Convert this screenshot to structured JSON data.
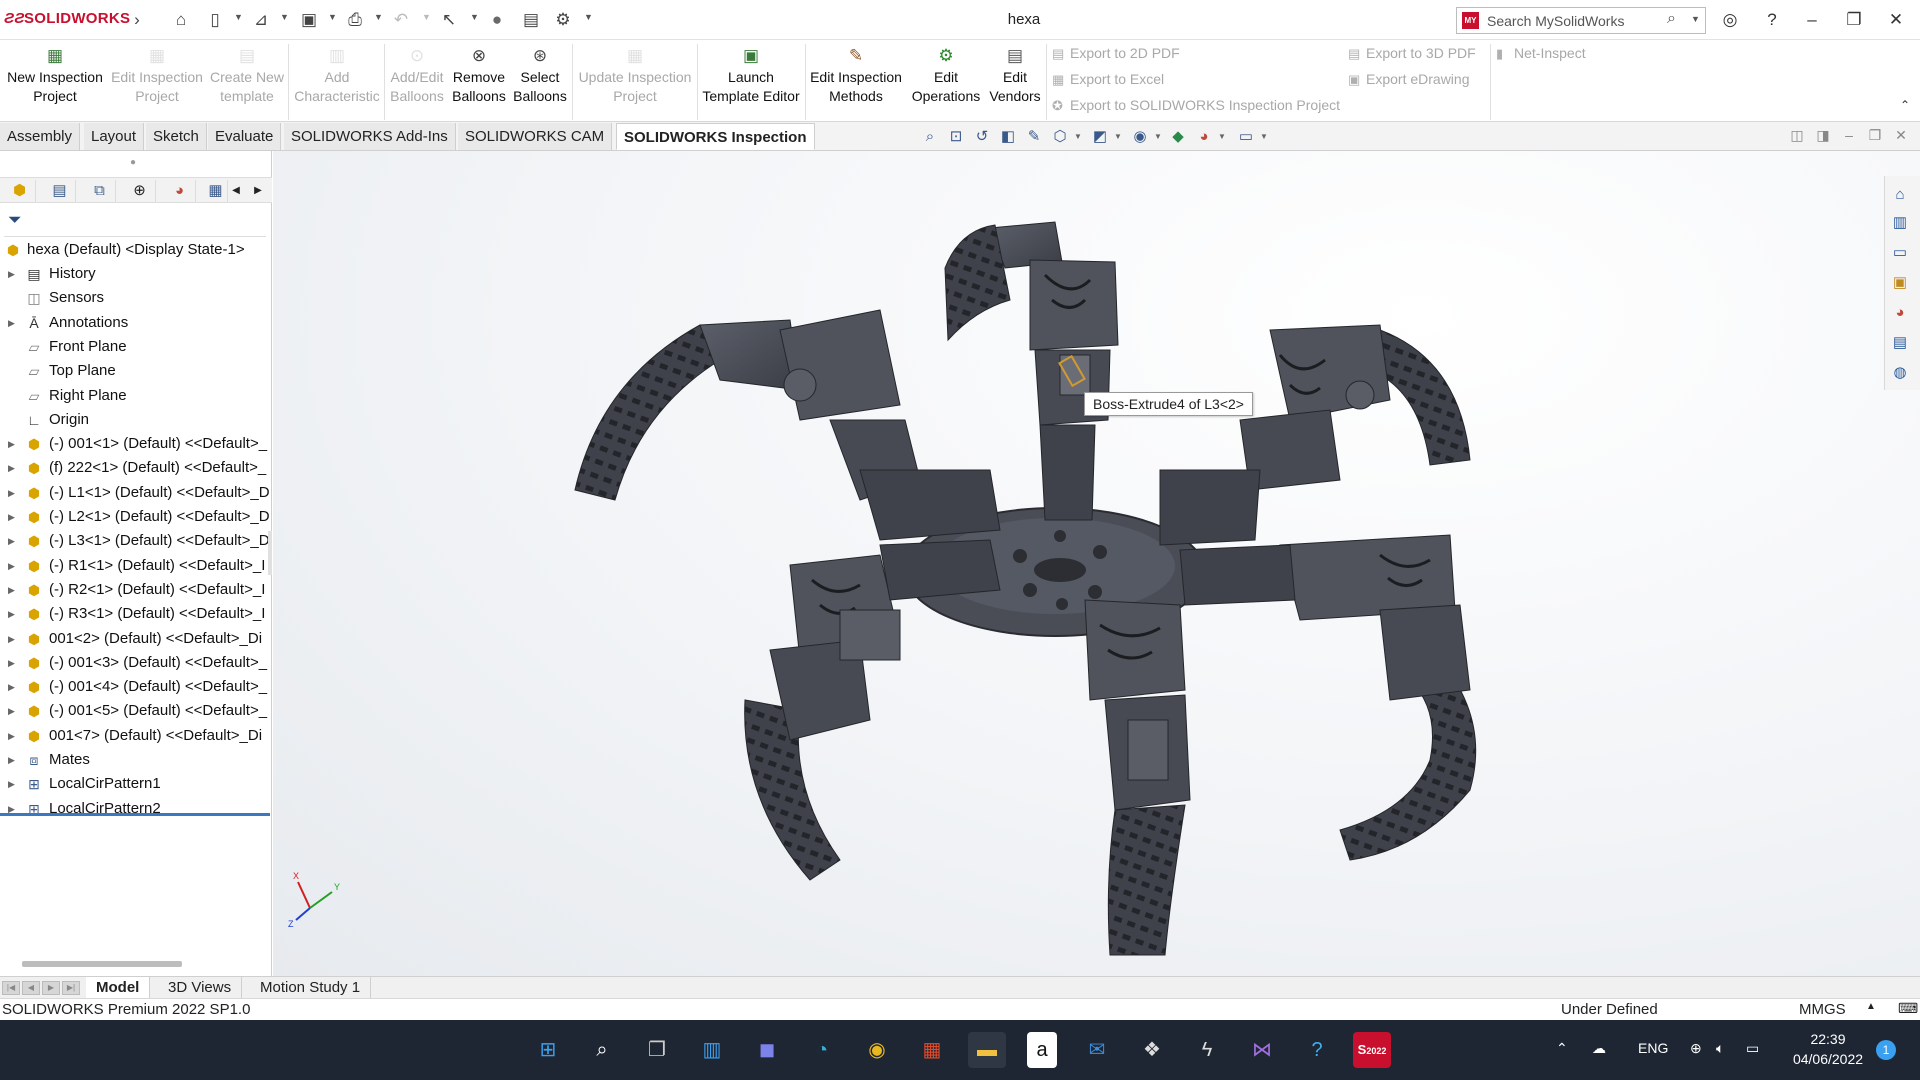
{
  "app": {
    "brand": "SOLIDWORKS",
    "document_title": "hexa",
    "search_placeholder": "Search MySolidWorks",
    "accent_color": "#c8102e"
  },
  "ribbon": {
    "buttons": [
      {
        "label": "New Inspection\nProject",
        "enabled": true,
        "icon": "new-inspection-project-icon"
      },
      {
        "label": "Edit Inspection\nProject",
        "enabled": false,
        "icon": "edit-inspection-project-icon"
      },
      {
        "label": "Create New\ntemplate",
        "enabled": false,
        "icon": "create-template-icon"
      },
      {
        "label": "Add\nCharacteristic",
        "enabled": false,
        "icon": "add-characteristic-icon"
      },
      {
        "label": "Add/Edit\nBalloons",
        "enabled": false,
        "icon": "add-edit-balloons-icon"
      },
      {
        "label": "Remove\nBalloons",
        "enabled": true,
        "icon": "remove-balloons-icon"
      },
      {
        "label": "Select\nBalloons",
        "enabled": true,
        "icon": "select-balloons-icon"
      },
      {
        "label": "Update Inspection\nProject",
        "enabled": false,
        "icon": "update-inspection-project-icon"
      },
      {
        "label": "Launch\nTemplate Editor",
        "enabled": true,
        "icon": "launch-template-editor-icon"
      },
      {
        "label": "Edit Inspection\nMethods",
        "enabled": true,
        "icon": "edit-inspection-methods-icon"
      },
      {
        "label": "Edit\nOperations",
        "enabled": true,
        "icon": "edit-operations-icon"
      },
      {
        "label": "Edit\nVendors",
        "enabled": true,
        "icon": "edit-vendors-icon"
      }
    ],
    "exports": {
      "pdf2d": "Export to 2D PDF",
      "excel": "Export to Excel",
      "inspection_project": "Export to SOLIDWORKS Inspection Project",
      "pdf3d": "Export to 3D PDF",
      "edrawing": "Export eDrawing",
      "net_inspect": "Net-Inspect"
    }
  },
  "tabs": [
    {
      "label": "Assembly",
      "active": false
    },
    {
      "label": "Layout",
      "active": false
    },
    {
      "label": "Sketch",
      "active": false
    },
    {
      "label": "Evaluate",
      "active": false
    },
    {
      "label": "SOLIDWORKS Add-Ins",
      "active": false
    },
    {
      "label": "SOLIDWORKS CAM",
      "active": false
    },
    {
      "label": "SOLIDWORKS Inspection",
      "active": true
    }
  ],
  "feature_tree": {
    "root": "hexa (Default) <Display State-1>",
    "items": [
      {
        "label": "History",
        "expandable": true,
        "icon": "history-icon"
      },
      {
        "label": "Sensors",
        "expandable": false,
        "icon": "sensors-icon"
      },
      {
        "label": "Annotations",
        "expandable": true,
        "icon": "annotations-icon"
      },
      {
        "label": "Front Plane",
        "expandable": false,
        "icon": "plane-icon"
      },
      {
        "label": "Top Plane",
        "expandable": false,
        "icon": "plane-icon"
      },
      {
        "label": "Right Plane",
        "expandable": false,
        "icon": "plane-icon"
      },
      {
        "label": "Origin",
        "expandable": false,
        "icon": "origin-icon"
      },
      {
        "label": "(-) 001<1> (Default) <<Default>_",
        "expandable": true,
        "icon": "part-icon"
      },
      {
        "label": "(f) 222<1> (Default) <<Default>_",
        "expandable": true,
        "icon": "part-icon"
      },
      {
        "label": "(-) L1<1> (Default) <<Default>_D",
        "expandable": true,
        "icon": "part-icon"
      },
      {
        "label": "(-) L2<1> (Default) <<Default>_D",
        "expandable": true,
        "icon": "part-icon"
      },
      {
        "label": "(-) L3<1> (Default) <<Default>_D",
        "expandable": true,
        "icon": "part-icon"
      },
      {
        "label": "(-) R1<1> (Default) <<Default>_I",
        "expandable": true,
        "icon": "part-icon"
      },
      {
        "label": "(-) R2<1> (Default) <<Default>_I",
        "expandable": true,
        "icon": "part-icon"
      },
      {
        "label": "(-) R3<1> (Default) <<Default>_I",
        "expandable": true,
        "icon": "part-icon"
      },
      {
        "label": "001<2> (Default) <<Default>_Di",
        "expandable": true,
        "icon": "part-icon"
      },
      {
        "label": "(-) 001<3> (Default) <<Default>_",
        "expandable": true,
        "icon": "part-icon"
      },
      {
        "label": "(-) 001<4> (Default) <<Default>_",
        "expandable": true,
        "icon": "part-icon"
      },
      {
        "label": "(-) 001<5> (Default) <<Default>_",
        "expandable": true,
        "icon": "part-icon"
      },
      {
        "label": "001<7> (Default) <<Default>_Di",
        "expandable": true,
        "icon": "part-icon"
      },
      {
        "label": "Mates",
        "expandable": true,
        "icon": "mates-icon"
      },
      {
        "label": "LocalCirPattern1",
        "expandable": true,
        "icon": "pattern-icon"
      },
      {
        "label": "LocalCirPattern2",
        "expandable": true,
        "icon": "pattern-icon"
      }
    ]
  },
  "viewport": {
    "tooltip": "Boss-Extrude4 of L3<2>",
    "model_color": "#4c4f58",
    "triad": {
      "x": "X",
      "y": "Y",
      "z": "Z"
    }
  },
  "bottom_tabs": [
    {
      "label": "Model",
      "active": true
    },
    {
      "label": "3D Views",
      "active": false
    },
    {
      "label": "Motion Study 1",
      "active": false
    }
  ],
  "status": {
    "version": "SOLIDWORKS Premium 2022 SP1.0",
    "state": "Under Defined",
    "units": "MMGS"
  },
  "taskbar": {
    "language": "ENG",
    "time": "22:39",
    "date": "04/06/2022",
    "notifications": "1",
    "sw_badge": "2022"
  }
}
